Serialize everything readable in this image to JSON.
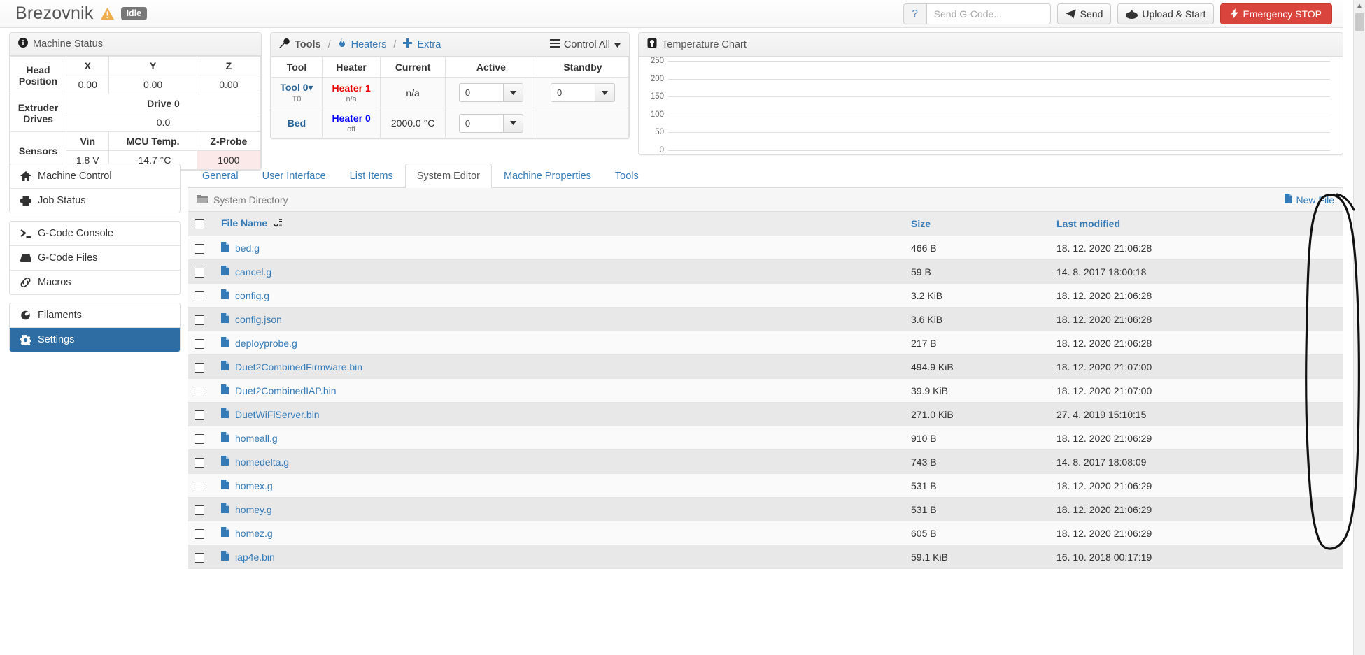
{
  "header": {
    "machine_name": "Brezovnik",
    "warning_icon": "warning-triangle-icon",
    "status": "Idle",
    "help_label": "?",
    "gcode_placeholder": "Send G-Code...",
    "gcode_value": "",
    "send_label": "Send",
    "upload_start_label": "Upload & Start",
    "emergency_label": "Emergency STOP",
    "emergency_color": "#d9453c"
  },
  "machine_status": {
    "title": "Machine Status",
    "icon": "info-circle-icon",
    "head_position_label": "Head Position",
    "axes": [
      "X",
      "Y",
      "Z"
    ],
    "axis_values": [
      "0.00",
      "0.00",
      "0.00"
    ],
    "extruder_label": "Extruder Drives",
    "drive_header": "Drive 0",
    "drive_value": "0.0",
    "sensors_label": "Sensors",
    "sensor_headers": [
      "Vin",
      "MCU Temp.",
      "Z-Probe"
    ],
    "sensor_values": [
      "1.8 V",
      "-14.7 °C",
      "1000"
    ]
  },
  "tools": {
    "title": "Tools",
    "tools_icon": "wrench-icon",
    "heaters_label": "Heaters",
    "heaters_icon": "fire-icon",
    "extra_label": "Extra",
    "extra_icon": "plus-icon",
    "control_all_label": "Control All",
    "control_all_icon": "bars-icon",
    "separator": "/",
    "columns": [
      "Tool",
      "Heater",
      "Current",
      "Active",
      "Standby"
    ],
    "rows": [
      {
        "tool": "Tool 0",
        "tool_sub": "T0",
        "heater": "Heater 1",
        "heater_color": "#ee0000",
        "heater_sub": "n/a",
        "current": "n/a",
        "active": "0",
        "standby": "0",
        "has_standby": true
      },
      {
        "tool": "Bed",
        "tool_sub": "",
        "heater": "Heater 0",
        "heater_color": "#0000ff",
        "heater_sub": "off",
        "current": "2000.0 °C",
        "active": "0",
        "standby": "",
        "has_standby": false
      }
    ]
  },
  "temperature_chart": {
    "title": "Temperature Chart",
    "icon": "chart-icon"
  },
  "chart_data": {
    "type": "line",
    "title": "Temperature Chart",
    "xlabel": "",
    "ylabel": "",
    "yticks": [
      250,
      200,
      150,
      100,
      50,
      0
    ],
    "ylim": [
      0,
      250
    ],
    "grid": true,
    "legend": "none",
    "series": []
  },
  "sidebar": {
    "groups": [
      {
        "items": [
          {
            "label": "Machine Control",
            "icon": "home-icon",
            "active": false
          },
          {
            "label": "Job Status",
            "icon": "printer-icon",
            "active": false
          }
        ]
      },
      {
        "items": [
          {
            "label": "G-Code Console",
            "icon": "terminal-icon",
            "active": false
          },
          {
            "label": "G-Code Files",
            "icon": "hdd-icon",
            "active": false
          },
          {
            "label": "Macros",
            "icon": "link-icon",
            "active": false
          }
        ]
      },
      {
        "items": [
          {
            "label": "Filaments",
            "icon": "spool-icon",
            "active": false
          },
          {
            "label": "Settings",
            "icon": "gear-icon",
            "active": true
          }
        ]
      }
    ]
  },
  "content": {
    "tabs": [
      {
        "label": "General",
        "active": false
      },
      {
        "label": "User Interface",
        "active": false
      },
      {
        "label": "List Items",
        "active": false
      },
      {
        "label": "System Editor",
        "active": true
      },
      {
        "label": "Machine Properties",
        "active": false
      },
      {
        "label": "Tools",
        "active": false
      }
    ],
    "directory_label": "System Directory",
    "directory_icon": "folder-open-icon",
    "new_file_label": "New File",
    "new_file_icon": "file-icon",
    "columns": {
      "file_name": "File Name",
      "sort_icon": "sort-alpha-down-icon",
      "size": "Size",
      "last_modified": "Last modified"
    },
    "files": [
      {
        "name": "bed.g",
        "size": "466 B",
        "modified": "18. 12. 2020 21:06:28"
      },
      {
        "name": "cancel.g",
        "size": "59 B",
        "modified": "14. 8. 2017 18:00:18"
      },
      {
        "name": "config.g",
        "size": "3.2 KiB",
        "modified": "18. 12. 2020 21:06:28"
      },
      {
        "name": "config.json",
        "size": "3.6 KiB",
        "modified": "18. 12. 2020 21:06:28"
      },
      {
        "name": "deployprobe.g",
        "size": "217 B",
        "modified": "18. 12. 2020 21:06:28"
      },
      {
        "name": "Duet2CombinedFirmware.bin",
        "size": "494.9 KiB",
        "modified": "18. 12. 2020 21:07:00"
      },
      {
        "name": "Duet2CombinedIAP.bin",
        "size": "39.9 KiB",
        "modified": "18. 12. 2020 21:07:00"
      },
      {
        "name": "DuetWiFiServer.bin",
        "size": "271.0 KiB",
        "modified": "27. 4. 2019 15:10:15"
      },
      {
        "name": "homeall.g",
        "size": "910 B",
        "modified": "18. 12. 2020 21:06:29"
      },
      {
        "name": "homedelta.g",
        "size": "743 B",
        "modified": "14. 8. 2017 18:08:09"
      },
      {
        "name": "homex.g",
        "size": "531 B",
        "modified": "18. 12. 2020 21:06:29"
      },
      {
        "name": "homey.g",
        "size": "531 B",
        "modified": "18. 12. 2020 21:06:29"
      },
      {
        "name": "homez.g",
        "size": "605 B",
        "modified": "18. 12. 2020 21:06:29"
      },
      {
        "name": "iap4e.bin",
        "size": "59.1 KiB",
        "modified": "16. 10. 2018 00:17:19"
      }
    ]
  },
  "scrollbar": {
    "up_arrow": "chevron-up-icon",
    "annotation": "hand-drawn-ellipse-highlight"
  }
}
